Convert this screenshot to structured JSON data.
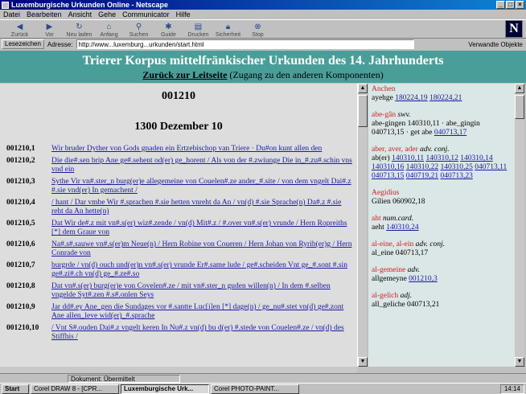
{
  "window": {
    "title": "Luxemburgische Urkunden Online - Netscape"
  },
  "menu": [
    "Datei",
    "Bearbeiten",
    "Ansicht",
    "Gehe",
    "Communicator",
    "Hilfe"
  ],
  "toolbar": [
    {
      "label": "Zurück",
      "icon": "back-icon"
    },
    {
      "label": "Vor",
      "icon": "forward-icon"
    },
    {
      "label": "Neu laden",
      "icon": "reload-icon"
    },
    {
      "label": "Anfang",
      "icon": "home-icon"
    },
    {
      "label": "Suchen",
      "icon": "search-icon"
    },
    {
      "label": "Guide",
      "icon": "guide-icon"
    },
    {
      "label": "Drucken",
      "icon": "print-icon"
    },
    {
      "label": "Sicherheit",
      "icon": "security-icon"
    },
    {
      "label": "Stop",
      "icon": "stop-icon"
    }
  ],
  "location": {
    "bookmarks_label": "Lesezeichen",
    "address_label": "Adresse:",
    "url": "http://www...luxemburg...urkunden/start.html",
    "related_label": "Verwandte Objekte"
  },
  "banner": {
    "title": "Trierer Korpus mittelfränkischer Urkunden des 14. Jahrhunderts",
    "back_link": "Zurück zur Leitseite",
    "back_note": "(Zugang zu den anderen Komponenten)"
  },
  "document": {
    "id": "001210",
    "date": "1300 Dezember 10",
    "lines": [
      {
        "num": "001210,1",
        "text": "Wir bruder Dyther von Gods gnaden ein Ertzebischop van Triere · Du#on kunt allen den"
      },
      {
        "num": "001210,2",
        "text": "Die die#.sen brip Ane ge#.sehent od(er) ge_horent / Als von der #.zwiunge Die in_#.zu#.schin vns vnd ein"
      },
      {
        "num": "001210,3",
        "text": "Sythe Vir vn#.ster_n burg(er)e allegemeine von Couelen#.ze ander_#.site / von dem vngelt Dai#.z #.sie vnd(er) In gemachent /"
      },
      {
        "num": "001210,4",
        "text": "/ hant / Dar vmbe Wir #.sprachen #.sie hetten vnreht da An / vn(d) #.sie Sprache(n) Da#.z #.sie reht da An hette(n)"
      },
      {
        "num": "001210,5",
        "text": "Dat Wir de#.z mit vn#.s(er) wiz#.zende / vn(d) Mit#.z / #.over vn#.s(er) vrunde / Hern Ropreiths [*] dem Graue von"
      },
      {
        "num": "001210,6",
        "text": "Na#.s#.sauwe vn#.s(er)m Neue(n) / Hern Robine von Coueren / Hern Johan von Ryrib(er)g / Hern Conrade von"
      },
      {
        "num": "001210,7",
        "text": "burgrde / vn(d) ouch und(er)n vn#.s(er) vrunde Er#.same lude / ge#.scheiden Vnt ge_#.sont #.sin ge#.zi#.ch vn(d) ge_#.ze#.so"
      },
      {
        "num": "001210,8",
        "text": "Dat vn#.s(er) burg(er)e von Covelen#.ze / mit vn#.ster_n guden willen(n) / In dem #.selben vngelde Syt#.zen #.s#.onlen Seys"
      },
      {
        "num": "001210,9",
        "text": "Jar dd#.ey Ane_gen die Sundages vor #.santte Luc[i]en [*] dage(n) / ge_nu#.stet vn(d) ge#.zont Ane allen_leve wid(er)_#.sprache"
      },
      {
        "num": "001210,10",
        "text": "/ Vnt S#.ouden Dai#.z vngelt keren In Nu#.z vn(d) bu d(er) #.stede von Couelen#.ze / vn(d) des Stiffhis /"
      }
    ]
  },
  "lemmas": [
    {
      "head": "Anchen",
      "pos": "",
      "body": "ayehge ",
      "refs": [
        "180224,19",
        "180224,21"
      ]
    },
    {
      "head": "abe-gân",
      "pos": "swv.",
      "body": "abe-gingen 140310,11 · abe_gingin 040713,15 · get abe ",
      "refs": [
        "040713,17"
      ]
    },
    {
      "head": "aber, aver, ader",
      "pos": "adv. conj.",
      "body": "ab(er) ",
      "refs": [
        "140310,11",
        "140310,12",
        "140310,14",
        "140310,16",
        "140310,22",
        "140310,25",
        "040713,11",
        "040713,15",
        "040719,21",
        "040713,23"
      ]
    },
    {
      "head": "Aegidius",
      "pos": "",
      "body": "Gilien 060902,18",
      "refs": []
    },
    {
      "head": "aht",
      "pos": "num.card.",
      "body": "aeht ",
      "refs": [
        "140310,24"
      ]
    },
    {
      "head": "al-eine, al-ein",
      "pos": "adv. conj.",
      "body": "al_eine 040713,17",
      "refs": []
    },
    {
      "head": "al-gemeine",
      "pos": "adv.",
      "body": "allgemeyne ",
      "refs": [
        "001210,3"
      ]
    },
    {
      "head": "al-gelich",
      "pos": "adj.",
      "body": "all_geliche 040713,21",
      "refs": []
    }
  ],
  "status": {
    "text": "Dokument: Übermittelt"
  },
  "taskbar": {
    "start": "Start",
    "items": [
      "Corel DRAW 8 - [CPR...",
      "Luxemburgische Urk...",
      "Corel PHOTO-PAINT..."
    ],
    "active_index": 1,
    "clock": "14:14"
  }
}
